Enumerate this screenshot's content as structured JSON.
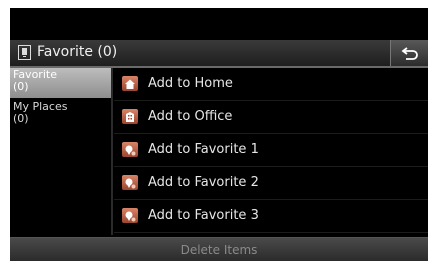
{
  "header": {
    "title": "Favorite (0)",
    "icon": "phone-bookmark-icon",
    "back_icon": "back-arrow-icon"
  },
  "sidebar": {
    "items": [
      {
        "label": "Favorite",
        "count": "(0)",
        "active": true
      },
      {
        "label": "My Places",
        "count": "(0)",
        "active": false
      }
    ]
  },
  "list": {
    "items": [
      {
        "label": "Add to Home",
        "icon": "home-icon"
      },
      {
        "label": "Add to Office",
        "icon": "office-icon"
      },
      {
        "label": "Add to Favorite 1",
        "icon": "favorite-pin-icon"
      },
      {
        "label": "Add to Favorite 2",
        "icon": "favorite-pin-icon"
      },
      {
        "label": "Add to Favorite 3",
        "icon": "favorite-pin-icon"
      }
    ]
  },
  "footer": {
    "delete_label": "Delete Items"
  },
  "colors": {
    "background": "#000000",
    "accent_icon": "#c86a4e",
    "active_tab": "#a8a8a8"
  }
}
